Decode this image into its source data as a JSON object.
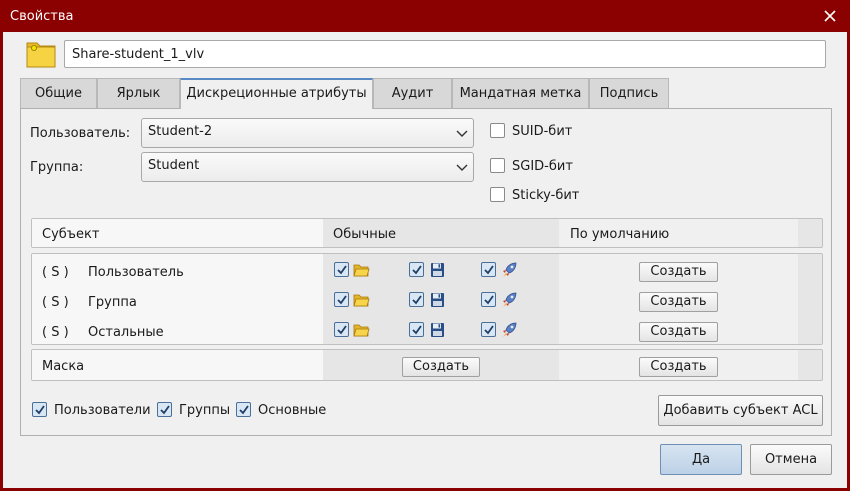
{
  "window": {
    "title": "Свойства"
  },
  "name_field": {
    "value": "Share-student_1_vlv"
  },
  "tabs": [
    {
      "label": "Общие",
      "active": false
    },
    {
      "label": "Ярлык",
      "active": false
    },
    {
      "label": "Дискреционные атрибуты",
      "active": true
    },
    {
      "label": "Аудит",
      "active": false
    },
    {
      "label": "Мандатная метка",
      "active": false
    },
    {
      "label": "Подпись",
      "active": false
    }
  ],
  "owner": {
    "user_label": "Пользователь:",
    "user_value": "Student-2",
    "group_label": "Группа:",
    "group_value": "Student"
  },
  "special_bits": [
    {
      "label": "SUID-бит",
      "checked": false
    },
    {
      "label": "SGID-бит",
      "checked": false
    },
    {
      "label": "Sticky-бит",
      "checked": false
    }
  ],
  "acl_header": {
    "subject": "Субъект",
    "normal": "Обычные",
    "default": "По умолчанию"
  },
  "acl_rows": [
    {
      "tag": "( S )",
      "subject": "Пользователь",
      "read": true,
      "write": true,
      "exec": true,
      "button": "Создать"
    },
    {
      "tag": "( S )",
      "subject": "Группа",
      "read": true,
      "write": true,
      "exec": true,
      "button": "Создать"
    },
    {
      "tag": "( S )",
      "subject": "Остальные",
      "read": true,
      "write": true,
      "exec": true,
      "button": "Создать"
    }
  ],
  "mask_row": {
    "label": "Маска",
    "normal_button": "Создать",
    "default_button": "Создать"
  },
  "filters": [
    {
      "label": "Пользователи",
      "checked": true
    },
    {
      "label": "Группы",
      "checked": true
    },
    {
      "label": "Основные",
      "checked": true
    }
  ],
  "add_subject_button": "Добавить субъект ACL",
  "dialog_buttons": {
    "ok": "Да",
    "cancel": "Отмена"
  },
  "colors": {
    "titlebar": "#8b0000",
    "accent": "#5a8ac6",
    "folder": "#f5d342"
  },
  "icons": {
    "close": "close-icon",
    "folder": "folder-icon",
    "dropdown": "chevron-down-icon",
    "read": "open-folder-icon",
    "write": "floppy-disk-icon",
    "exec": "rocket-icon"
  }
}
